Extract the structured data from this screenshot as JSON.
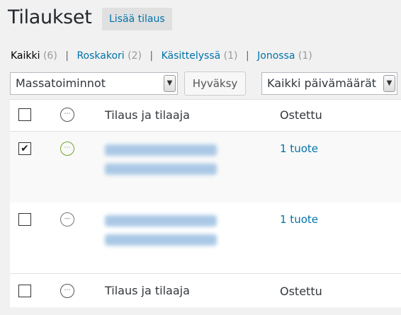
{
  "page": {
    "title": "Tilaukset",
    "add_new_label": "Lisää tilaus"
  },
  "filters": {
    "items": [
      {
        "label": "Kaikki",
        "count": "(6)",
        "current": true
      },
      {
        "label": "Roskakori",
        "count": "(2)"
      },
      {
        "label": "Käsittelyssä",
        "count": "(1)"
      },
      {
        "label": "Jonossa",
        "count": "(1)"
      }
    ],
    "separator": "|"
  },
  "bulk_actions": {
    "selected": "Massatoiminnot",
    "apply_label": "Hyväksy"
  },
  "date_filter": {
    "selected": "Kaikki päivämäärät"
  },
  "table": {
    "columns": {
      "status": "status-icon",
      "order": "Tilaus ja tilaaja",
      "purchased": "Ostettu"
    },
    "rows": [
      {
        "checked": true,
        "status": "processing",
        "purchased": "1 tuote"
      },
      {
        "checked": false,
        "status": "cancelled",
        "purchased": "1 tuote"
      }
    ]
  },
  "colors": {
    "accent": "#0073aa",
    "processing": "#73a724",
    "background": "#f1f1f1"
  }
}
